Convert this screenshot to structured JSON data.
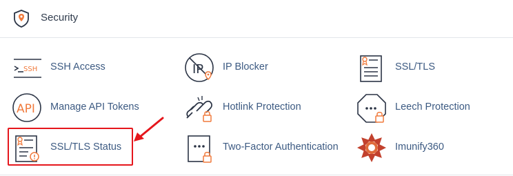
{
  "header": {
    "title": "Security",
    "icon": "shield-pin-icon"
  },
  "tools": [
    {
      "label": "SSH Access",
      "icon": "ssh-terminal-icon",
      "icon_text": ">_SSH"
    },
    {
      "label": "IP Blocker",
      "icon": "ip-blocker-icon",
      "icon_text": "IP"
    },
    {
      "label": "SSL/TLS",
      "icon": "certificate-icon"
    },
    {
      "label": "Manage API Tokens",
      "icon": "api-icon",
      "icon_text": "API"
    },
    {
      "label": "Hotlink Protection",
      "icon": "broken-link-lock-icon"
    },
    {
      "label": "Leech Protection",
      "icon": "octagon-password-lock-icon"
    },
    {
      "label": "SSL/TLS Status",
      "icon": "certificate-status-icon"
    },
    {
      "label": "Two-Factor Authentication",
      "icon": "two-factor-lock-icon"
    },
    {
      "label": "Imunify360",
      "icon": "imunify360-logo-icon"
    }
  ],
  "annotation": {
    "highlighted_item": "SSL/TLS Status",
    "color": "#e5161c"
  },
  "colors": {
    "link": "#3c5a82",
    "icon_stroke": "#2b3445",
    "accent": "#f07a3c",
    "border": "#e3e6ea"
  }
}
